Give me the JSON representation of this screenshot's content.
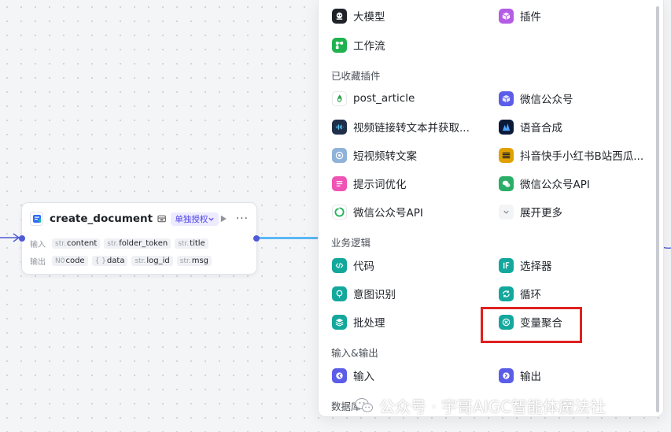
{
  "node": {
    "title": "create_document",
    "auth_badge": "单独授权",
    "input_label": "输入",
    "output_label": "输出",
    "inputs": [
      {
        "type": "str.",
        "name": "content"
      },
      {
        "type": "str.",
        "name": "folder_token"
      },
      {
        "type": "str.",
        "name": "title"
      }
    ],
    "outputs": [
      {
        "type": "N0",
        "name": "code"
      },
      {
        "type": "{ }",
        "name": "data"
      },
      {
        "type": "str.",
        "name": "log_id"
      },
      {
        "type": "str.",
        "name": "msg"
      }
    ]
  },
  "panel": {
    "top_items": [
      {
        "label": "大模型",
        "icon": "llm-icon",
        "color": "#1f2329"
      },
      {
        "label": "插件",
        "icon": "plugin-icon",
        "color": "#b45ce6"
      },
      {
        "label": "工作流",
        "icon": "workflow-icon",
        "color": "#1fb34f"
      }
    ],
    "sections": {
      "favorites": "已收藏插件",
      "logic": "业务逻辑",
      "io": "输入&输出",
      "db": "数据库"
    },
    "favorites": [
      {
        "label": "post_article",
        "icon": "post-article-icon",
        "color": "#2ea44f"
      },
      {
        "label": "微信公众号",
        "icon": "wechat-cube-icon",
        "color": "#5b5ce8"
      },
      {
        "label": "视频链接转文本并获取...",
        "icon": "video-text-icon",
        "color": "#1f2f4a"
      },
      {
        "label": "语音合成",
        "icon": "speech-synthesis-icon",
        "color": "#0c1a3a"
      },
      {
        "label": "短视频转文案",
        "icon": "short-video-icon",
        "color": "#8fb2d9"
      },
      {
        "label": "抖音快手小红书B站西瓜...",
        "icon": "multi-platform-icon",
        "color": "#e0a100"
      },
      {
        "label": "提示词优化",
        "icon": "prompt-optimize-icon",
        "color": "#f052b5"
      },
      {
        "label": "微信公众号API",
        "icon": "wechat-api-icon",
        "color": "#2aae67"
      },
      {
        "label": "微信公众号API",
        "icon": "wechat-api-green-icon",
        "color": "#21b35a"
      },
      {
        "label": "展开更多",
        "icon": "chevron-down-icon",
        "color": "#8f959e"
      }
    ],
    "logic": [
      {
        "label": "代码",
        "icon": "code-icon",
        "color": "#14a89d"
      },
      {
        "label": "选择器",
        "icon": "selector-icon",
        "color": "#14a89d"
      },
      {
        "label": "意图识别",
        "icon": "intent-icon",
        "color": "#14a89d"
      },
      {
        "label": "循环",
        "icon": "loop-icon",
        "color": "#14a89d"
      },
      {
        "label": "批处理",
        "icon": "batch-icon",
        "color": "#14a89d"
      },
      {
        "label": "变量聚合",
        "icon": "variable-aggregate-icon",
        "color": "#14a89d"
      }
    ],
    "io": [
      {
        "label": "输入",
        "icon": "input-icon",
        "color": "#5b5ce8"
      },
      {
        "label": "输出",
        "icon": "output-icon",
        "color": "#5b5ce8"
      }
    ]
  },
  "watermark": "公众号 · 宇哥AIGC智能体魔法社"
}
